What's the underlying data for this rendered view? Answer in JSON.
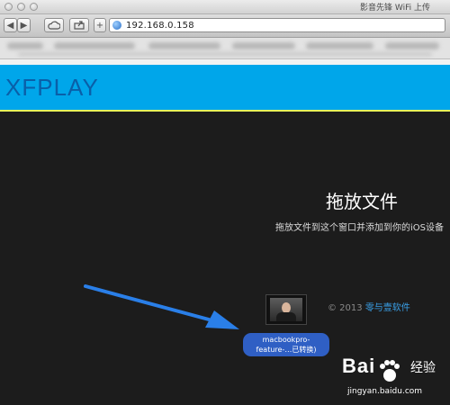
{
  "window": {
    "title": "影音先锋 WiFi 上传"
  },
  "toolbar": {
    "address": "192.168.0.158"
  },
  "header": {
    "logo": "XFPLAY"
  },
  "main": {
    "drop_title": "拖放文件",
    "drop_subtitle": "拖放文件到这个窗口并添加到你的iOS设备",
    "copyright_prefix": "© 2013 ",
    "copyright_brand": "零与壹软件"
  },
  "drag_file": {
    "name_line1": "macbookpro-",
    "name_line2": "feature-…已转换)"
  },
  "watermark": {
    "brand": "Bai",
    "brand2": "经验",
    "url": "jingyan.baidu.com"
  },
  "colors": {
    "header_bg": "#00a6ea",
    "header_border": "#e6f25a",
    "arrow": "#2a7fe8",
    "label_bg": "#2f5fc4"
  }
}
